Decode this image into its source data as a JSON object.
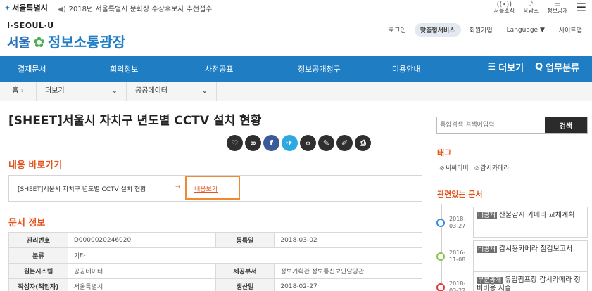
{
  "topbar": {
    "seoul": "서울특별시",
    "notice": "2018년 서울특별시 문화상 수상후보자 추천접수",
    "icons": [
      {
        "name": "seoul-news-icon",
        "label": "서울소식"
      },
      {
        "name": "answer-icon",
        "label": "응답소"
      },
      {
        "name": "info-open-icon",
        "label": "정보공개"
      }
    ]
  },
  "brand": {
    "top": "I·SEOUL·U",
    "main": "정보소통광장"
  },
  "util_links": [
    "로그인",
    "맞춤형서비스",
    "회원가입",
    "Language ▼",
    "사이트맵"
  ],
  "nav": {
    "items": [
      "결재문서",
      "회의정보",
      "사전공표",
      "정보공개청구",
      "이용안내"
    ],
    "more": "더보기",
    "category": "업무분류"
  },
  "breadcrumb": {
    "home": "홈",
    "level1": "더보기",
    "level2": "공공데이터"
  },
  "doc": {
    "title": "[SHEET]서울시 자치구 년도별 CCTV 설치 현황",
    "share_icons": [
      "like-icon",
      "link-icon",
      "facebook-icon",
      "twitter-icon",
      "embed-icon",
      "edit-icon",
      "pencil-icon",
      "print-icon"
    ]
  },
  "shortcut": {
    "heading": "내용 바로가기",
    "text": "[SHEET]서울시 자치구 년도별 CCTV 설치 현황",
    "button": "내용보기"
  },
  "info": {
    "heading": "문서 정보",
    "rows": [
      {
        "k1": "관리번호",
        "v1": "D0000020246020",
        "k2": "등록일",
        "v2": "2018-03-02"
      },
      {
        "k1": "분류",
        "v1": "기타",
        "k2": "",
        "v2": ""
      },
      {
        "k1": "원본시스템",
        "v1": "공공데이터",
        "k2": "제공부서",
        "v2": "정보기획관 정보통신보안담당관"
      },
      {
        "k1": "작성자(책임자)",
        "v1": "서울특별시",
        "k2": "생산일",
        "v2": "2018-02-27"
      }
    ]
  },
  "search": {
    "placeholder": "통합검색 검색어입력",
    "button": "검색"
  },
  "tags": {
    "heading": "태그",
    "items": [
      "씨씨티비",
      "감시카메라"
    ]
  },
  "related": {
    "heading": "관련있는 문서",
    "items": [
      {
        "date1": "2018-",
        "date2": "03-27",
        "badge": "비공개",
        "title": "산불감시 카메라 교체계획",
        "color": "blue"
      },
      {
        "date1": "2016-",
        "date2": "11-08",
        "badge": "비공개",
        "title": "감시용카메라 점검보고서",
        "color": "green"
      },
      {
        "date1": "2018-",
        "date2": "03-22",
        "badge": "부분공개",
        "title": "유입펌프장 감시카메라 정비비용 지출",
        "color": "red"
      }
    ]
  }
}
